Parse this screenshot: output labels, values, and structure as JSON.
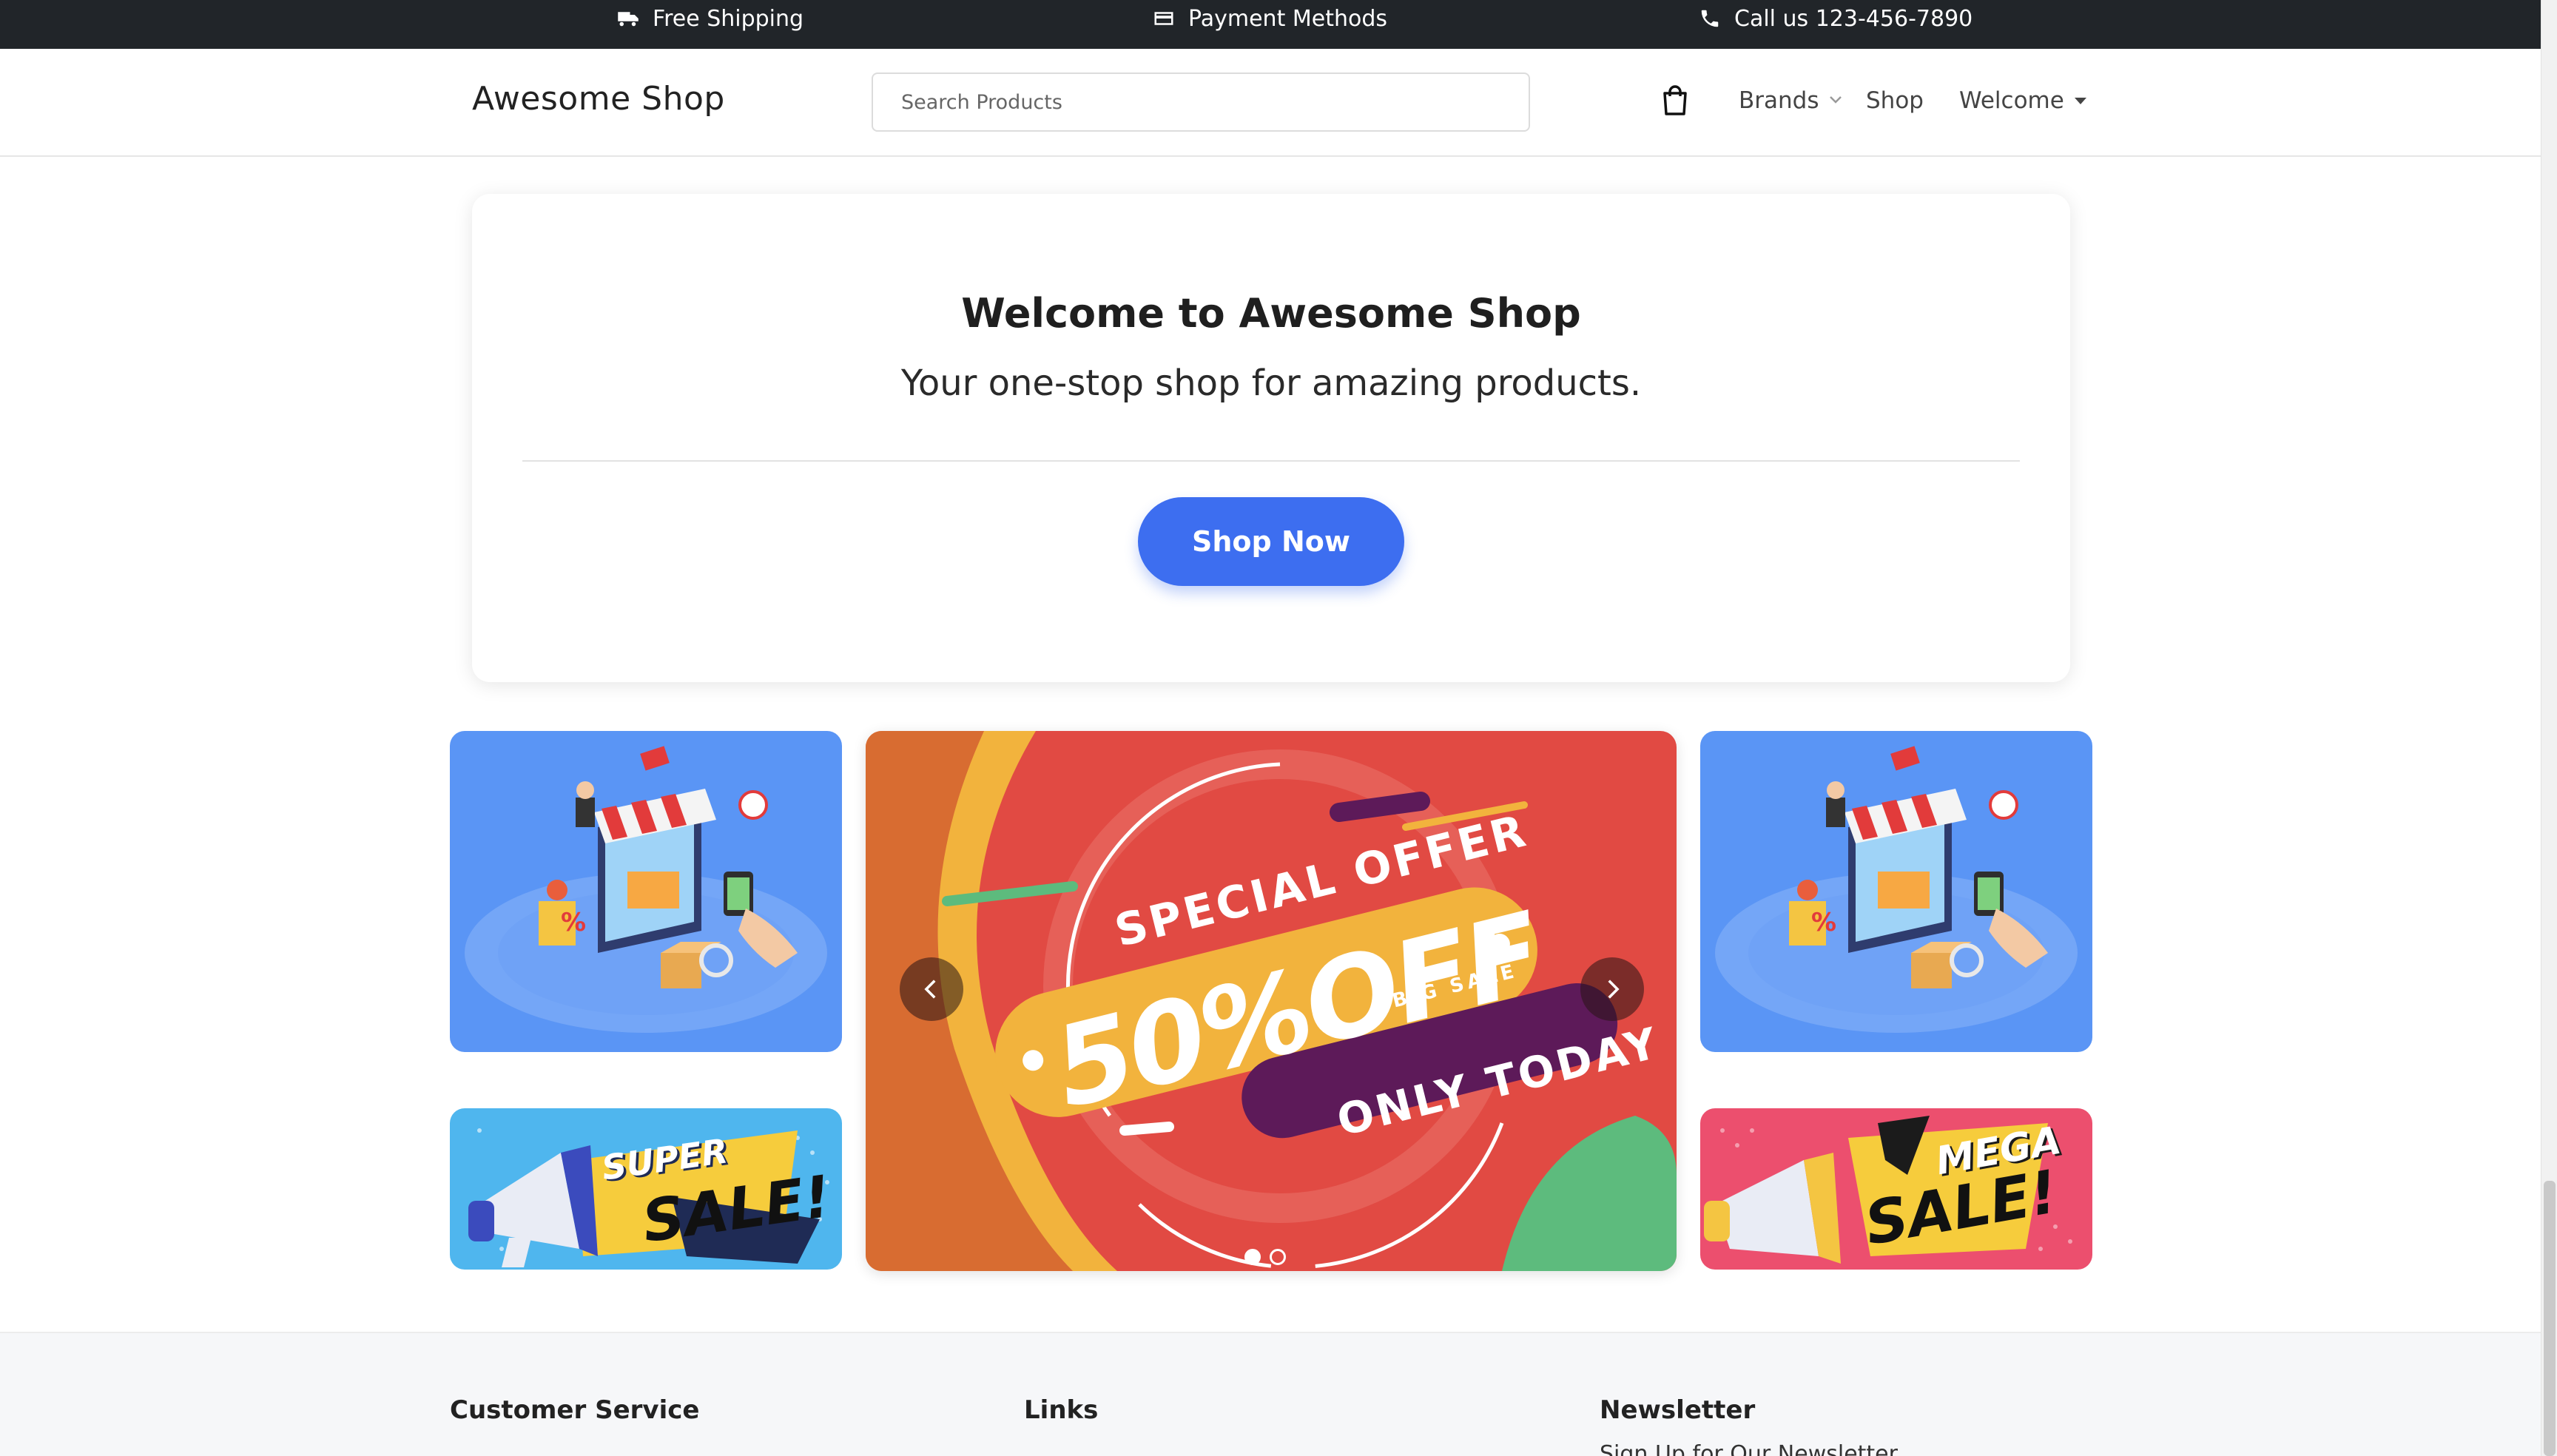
{
  "topbar": {
    "shipping": "Free Shipping",
    "payment": "Payment Methods",
    "phone": "Call us 123-456-7890"
  },
  "navbar": {
    "brand": "Awesome Shop",
    "search_placeholder": "Search Products",
    "links": {
      "brands": "Brands",
      "shop": "Shop",
      "welcome": "Welcome"
    }
  },
  "hero": {
    "title": "Welcome to Awesome Shop",
    "subtitle": "Your one-stop shop for amazing products.",
    "button": "Shop Now"
  },
  "banners": {
    "left_bottom": {
      "line1": "SUPER",
      "line2": "SALE!"
    },
    "right_bottom": {
      "line1": "MEGA",
      "line2": "SALE!"
    },
    "carousel": {
      "headline": "SPECIAL OFFER",
      "discount": "50%OFF",
      "tag": "BIG SALE",
      "footer": "ONLY TODAY",
      "slides": 2,
      "active_slide": 1
    }
  },
  "footer": {
    "customer_service": "Customer Service",
    "links": "Links",
    "newsletter": "Newsletter",
    "newsletter_text": "Sign Up for Our Newsletter"
  },
  "colors": {
    "topbar": "#212529",
    "primary_button": "#3d6ef0",
    "banner_blue": "#5a95f5",
    "carousel_red": "#e14a43",
    "mega_pink": "#ec4f6e"
  },
  "icons": [
    "truck-icon",
    "credit-card-icon",
    "phone-icon",
    "shopping-bag-icon",
    "chevron-down-icon",
    "caret-down-icon",
    "chevron-left-icon",
    "chevron-right-icon",
    "megaphone-icon"
  ]
}
